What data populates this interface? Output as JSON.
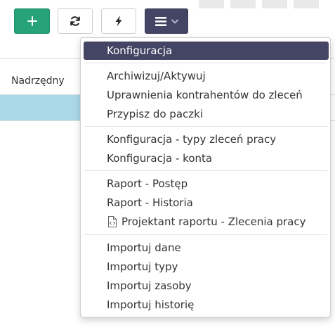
{
  "toolbar": {
    "add_icon": "plus-icon",
    "refresh_icon": "refresh-icon",
    "bolt_icon": "lightning-icon",
    "menu_icon": "hamburger-icon",
    "caret_icon": "chevron-down-icon",
    "add_color": "#27a37a",
    "menu_color": "#444564"
  },
  "table": {
    "columns": [
      "Nadrzędny"
    ],
    "selected_row_color": "#abd8e7"
  },
  "menu": {
    "groups": [
      [
        "Konfiguracja"
      ],
      [
        "Archiwizuj/Aktywuj",
        "Uprawnienia kontrahentów do zleceń",
        "Przypisz do paczki"
      ],
      [
        "Konfiguracja - typy zleceń pracy",
        "Konfiguracja - konta"
      ],
      [
        "Raport - Postęp",
        "Raport - Historia",
        "Projektant raportu - Zlecenia pracy"
      ],
      [
        "Importuj dane",
        "Importuj typy",
        "Importuj zasoby",
        "Importuj historię"
      ]
    ],
    "active_item": "Konfiguracja",
    "report_designer_icon": "code-file-icon"
  }
}
